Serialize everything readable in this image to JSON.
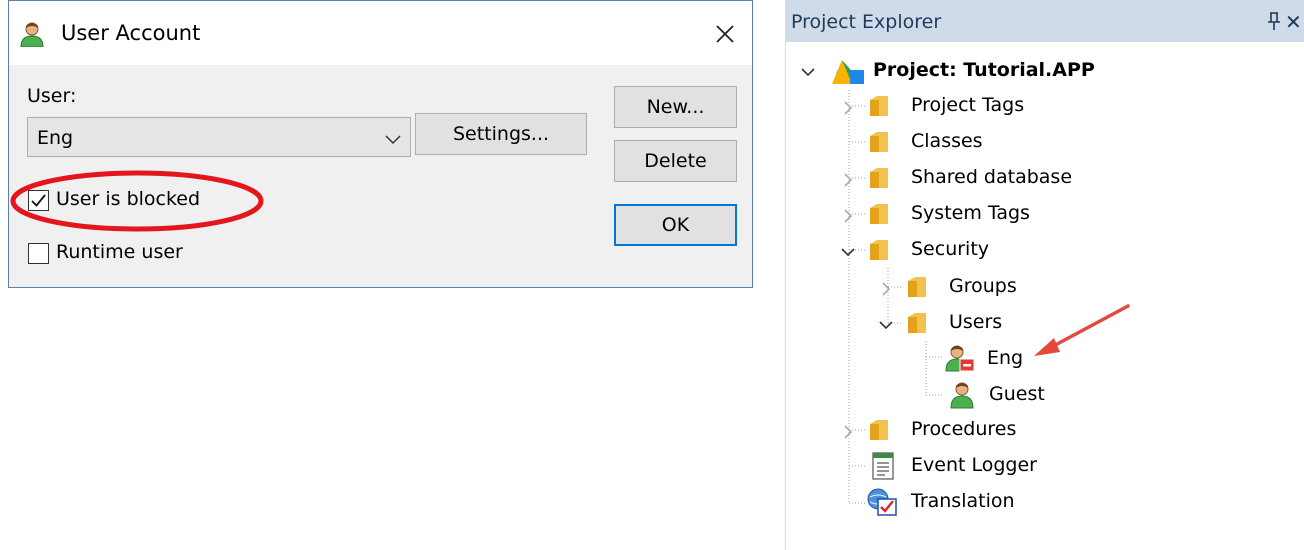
{
  "dialog": {
    "title": "User Account",
    "user_label": "User:",
    "user_value": "Eng",
    "settings_label": "Settings...",
    "new_label": "New...",
    "delete_label": "Delete",
    "ok_label": "OK",
    "blocked_label": "User is blocked",
    "blocked_checked": true,
    "runtime_label": "Runtime user",
    "runtime_checked": false,
    "highlight_color": "#e3161e",
    "icons": {
      "title": "user-icon",
      "close": "close-icon",
      "dropdown": "chevron-down-icon",
      "check": "checkmark-icon"
    }
  },
  "explorer": {
    "title": "Project Explorer",
    "pin_icon": "pin-icon",
    "close_icon": "close-icon",
    "tree": {
      "root": "Project: Tutorial.APP",
      "project_tags": "Project Tags",
      "classes": "Classes",
      "shared_database": "Shared database",
      "system_tags": "System Tags",
      "security": "Security",
      "groups": "Groups",
      "users": "Users",
      "eng": "Eng",
      "guest": "Guest",
      "procedures": "Procedures",
      "event_logger": "Event Logger",
      "translation": "Translation"
    },
    "arrow_color": "#e34a3c",
    "header_color": "#cfdbe9"
  }
}
